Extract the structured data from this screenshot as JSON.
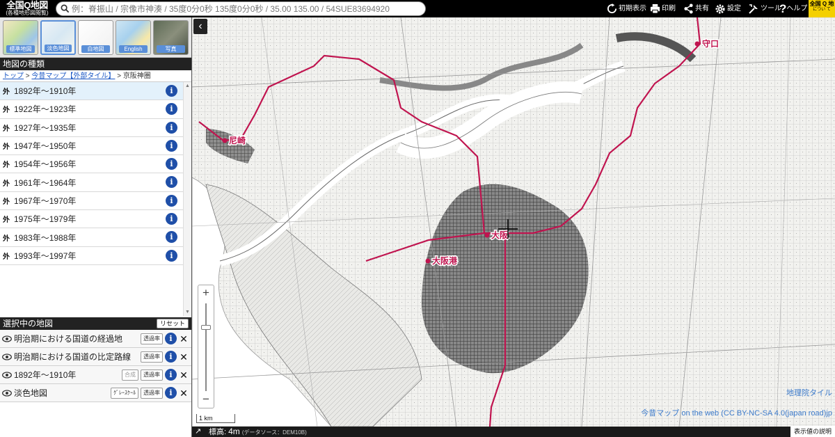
{
  "header": {
    "logo_line1": "全国Q地図",
    "logo_line2": "(各種地形図閲覧)",
    "search_placeholder": "例：脊振山 / 宗像市神湊 / 35度0分0秒 135度0分0秒 / 35.00 135.00 / 54SUE83694920",
    "buttons": {
      "home": "初期表示",
      "print": "印刷",
      "share": "共有",
      "settings": "設定",
      "tools": "ツール",
      "help": "ヘルプ"
    },
    "badge_line1": "全国 Q 地",
    "badge_line2": "につい て"
  },
  "basemaps": [
    {
      "label": "標準地図"
    },
    {
      "label": "淡色地図"
    },
    {
      "label": "白地図"
    },
    {
      "label": "English"
    },
    {
      "label": "写真"
    }
  ],
  "map_types": {
    "title": "地図の種類",
    "breadcrumb": {
      "top": "トップ",
      "sep": ">",
      "level1": "今昔マップ【外部タイル】",
      "current": "京阪神圏"
    },
    "prefix": "外",
    "items": [
      {
        "label": "1892年～1910年",
        "selected": true
      },
      {
        "label": "1922年～1923年"
      },
      {
        "label": "1927年～1935年"
      },
      {
        "label": "1947年～1950年"
      },
      {
        "label": "1954年～1956年"
      },
      {
        "label": "1961年～1964年"
      },
      {
        "label": "1967年～1970年"
      },
      {
        "label": "1975年～1979年"
      },
      {
        "label": "1983年～1988年"
      },
      {
        "label": "1993年～1997年"
      }
    ]
  },
  "selected_maps": {
    "title": "選択中の地図",
    "reset_label": "リセット",
    "transparency_label": "透過率",
    "composite_label": "合成",
    "grayscale_label": "ｸﾞﾚｰｽｹｰﾙ",
    "items": [
      {
        "label": "明治期における国道の経過地"
      },
      {
        "label": "明治期における国道の比定路線"
      },
      {
        "label": "1892年～1910年"
      },
      {
        "label": "淡色地図"
      }
    ]
  },
  "map": {
    "cities": {
      "moriguchi": "守口",
      "amagasaki": "尼崎",
      "osaka": "大阪",
      "osakako": "大阪港"
    },
    "scale_label": "1 km",
    "attribution1": "地理院タイル",
    "attribution2": "今昔マップ on the web (CC BY-NC-SA 4.0(japan road)jp",
    "route_color": "#c0144f"
  },
  "bottom": {
    "elevation_label": "標高:",
    "elevation_value": "4m",
    "elevation_source": "(データソース：DEM10B)",
    "explain_label": "表示値の説明"
  }
}
